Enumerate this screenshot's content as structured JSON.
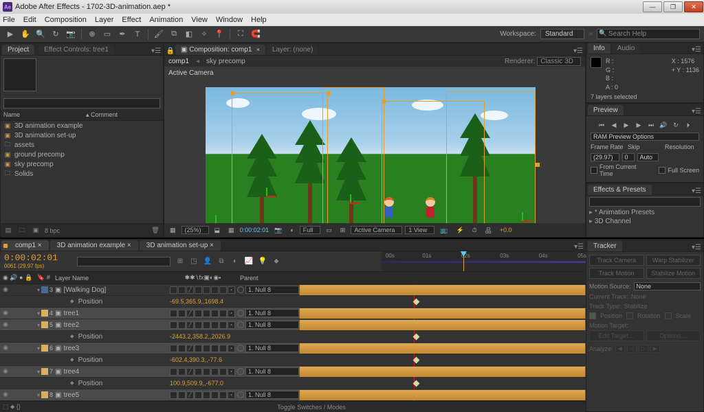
{
  "title": "Adobe After Effects - 1702-3D-animation.aep *",
  "menubar": [
    "File",
    "Edit",
    "Composition",
    "Layer",
    "Effect",
    "Animation",
    "View",
    "Window",
    "Help"
  ],
  "workspace": {
    "label": "Workspace:",
    "value": "Standard"
  },
  "search_help_placeholder": "Search Help",
  "project": {
    "tabs": [
      "Project",
      "Effect Controls: tree1"
    ],
    "cols": {
      "name": "Name",
      "comment": "Comment"
    },
    "items": [
      {
        "type": "comp",
        "label": "3D animation example"
      },
      {
        "type": "comp",
        "label": "3D animation set-up"
      },
      {
        "type": "folder",
        "label": "assets"
      },
      {
        "type": "comp",
        "label": "ground precomp"
      },
      {
        "type": "comp",
        "label": "sky precomp"
      },
      {
        "type": "folder",
        "label": "Solids"
      }
    ],
    "footer_bpc": "8 bpc"
  },
  "comp": {
    "tabs": [
      "Composition: comp1",
      "Layer: (none)"
    ],
    "subtabs": [
      "comp1",
      "sky precomp"
    ],
    "renderer_label": "Renderer:",
    "renderer_value": "Classic 3D",
    "camera_label": "Active Camera",
    "footer": {
      "zoom": "(25%)",
      "timecode": "0:00:02:01",
      "res": "Full",
      "view": "Active Camera",
      "views": "1 View",
      "exposure": "+0.0"
    }
  },
  "info": {
    "tabs": [
      "Info",
      "Audio"
    ],
    "r": "R :",
    "g": "G :",
    "b": "B :",
    "a": "A :  0",
    "x": "X : 1576",
    "y": "Y : 1136",
    "sel": "7 layers selected"
  },
  "preview": {
    "tab": "Preview",
    "ram_label": "RAM Preview Options",
    "fr_label": "Frame Rate",
    "skip_label": "Skip",
    "res_label": "Resolution",
    "fr_val": "(29.97)",
    "skip_val": "0",
    "res_val": "Auto",
    "from_current": "From Current Time",
    "full_screen": "Full Screen"
  },
  "effects": {
    "tab": "Effects & Presets",
    "items": [
      "* Animation Presets",
      "3D Channel"
    ]
  },
  "timeline": {
    "tabs": [
      "comp1",
      "3D animation example",
      "3D animation set-up"
    ],
    "timecode": "0:00:02:01",
    "fps": "0061 (29.97 fps)",
    "cols": {
      "layer": "Layer Name",
      "parent": "Parent"
    },
    "ruler": [
      "00s",
      "01s",
      "02s",
      "03s",
      "04s",
      "05s"
    ],
    "rows": [
      {
        "idx": "3",
        "name": "[Walking Dog]",
        "parent": "1. Null 8",
        "color": "#4a6a90",
        "bar": true
      },
      {
        "prop": true,
        "name": "Position",
        "val": "-69.5,365.9,,1698.4",
        "kf": true
      },
      {
        "idx": "4",
        "name": "tree1",
        "parent": "1. Null 8",
        "color": "#d8b060",
        "bar": true,
        "sel": true
      },
      {
        "idx": "5",
        "name": "tree2",
        "parent": "1. Null 8",
        "color": "#d8b060",
        "bar": true,
        "sel": true
      },
      {
        "prop": true,
        "name": "Position",
        "val": "-2443.2,358.2,,2026.9",
        "kf": true
      },
      {
        "idx": "6",
        "name": "tree3",
        "parent": "1. Null 8",
        "color": "#d8b060",
        "bar": true,
        "sel": true
      },
      {
        "prop": true,
        "name": "Position",
        "val": "-602.4,390.3,,-77.6",
        "kf": true
      },
      {
        "idx": "7",
        "name": "tree4",
        "parent": "1. Null 8",
        "color": "#d8b060",
        "bar": true,
        "sel": true
      },
      {
        "prop": true,
        "name": "Position",
        "val": "100.9,509.9,,-677.0",
        "kf": true
      },
      {
        "idx": "8",
        "name": "tree5",
        "parent": "1. Null 8",
        "color": "#d8b060",
        "bar": true,
        "sel": true
      }
    ],
    "footer": "Toggle Switches / Modes"
  },
  "tracker": {
    "tab": "Tracker",
    "btns": [
      "Track Camera",
      "Warp Stabilizer",
      "Track Motion",
      "Stabilize Motion"
    ],
    "motion_src_label": "Motion Source:",
    "motion_src_val": "None",
    "cur_track_label": "Current Track:",
    "cur_track_val": "None",
    "track_type_label": "Track Type:",
    "track_type_val": "Stabilize",
    "chk_pos": "Position",
    "chk_rot": "Rotation",
    "chk_scale": "Scale",
    "motion_target": "Motion Target:",
    "edit_target": "Edit Target…",
    "options": "Options…",
    "analyze": "Analyze:"
  }
}
